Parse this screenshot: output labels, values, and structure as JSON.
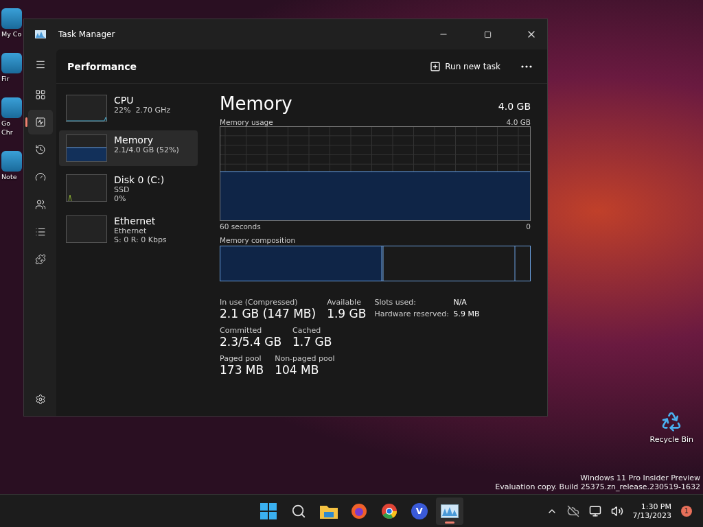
{
  "desktop_icons": [
    {
      "lines": [
        "My Co"
      ]
    },
    {
      "lines": [
        "Fir"
      ]
    },
    {
      "lines": [
        "Go",
        "Chr"
      ]
    },
    {
      "lines": [
        "Note"
      ]
    }
  ],
  "recycle_bin": {
    "label": "Recycle Bin"
  },
  "watermark": [
    "Windows 11 Pro Insider Preview",
    "Evaluation copy. Build 25375.zn_release.230519-1632"
  ],
  "window": {
    "title": "Task Manager"
  },
  "nav": [
    {
      "kind": "menu",
      "selected": false
    },
    {
      "kind": "processes",
      "selected": false
    },
    {
      "kind": "performance",
      "selected": true
    },
    {
      "kind": "history",
      "selected": false
    },
    {
      "kind": "startup",
      "selected": false
    },
    {
      "kind": "users",
      "selected": false
    },
    {
      "kind": "details",
      "selected": false
    },
    {
      "kind": "services",
      "selected": false
    }
  ],
  "header": {
    "title": "Performance",
    "run_task": "Run new task"
  },
  "devices": [
    {
      "kind": "cpu",
      "name": "CPU",
      "lines": [
        "22%  2.70 GHz"
      ],
      "selected": false
    },
    {
      "kind": "memory",
      "name": "Memory",
      "lines": [
        "2.1/4.0 GB (52%)"
      ],
      "selected": true
    },
    {
      "kind": "disk",
      "name": "Disk 0 (C:)",
      "lines": [
        "SSD",
        "0%"
      ],
      "selected": false
    },
    {
      "kind": "net",
      "name": "Ethernet",
      "lines": [
        "Ethernet",
        "S: 0 R: 0 Kbps"
      ],
      "selected": false
    }
  ],
  "detail": {
    "title": "Memory",
    "total": "4.0 GB",
    "usage_label": "Memory usage",
    "usage_max": "4.0 GB",
    "time_label": "60 seconds",
    "time_end": "0",
    "composition_label": "Memory composition",
    "stats": [
      [
        {
          "label": "In use (Compressed)",
          "value": "2.1 GB (147 MB)"
        },
        {
          "label": "Available",
          "value": "1.9 GB"
        }
      ],
      [
        {
          "label": "Committed",
          "value": "2.3/5.4 GB"
        },
        {
          "label": "Cached",
          "value": "1.7 GB"
        }
      ],
      [
        {
          "label": "Paged pool",
          "value": "173 MB"
        },
        {
          "label": "Non-paged pool",
          "value": "104 MB"
        }
      ]
    ],
    "side": [
      {
        "label": "Slots used:",
        "value": "N/A"
      },
      {
        "label": "Hardware reserved:",
        "value": "5.9 MB"
      }
    ]
  },
  "taskbar": {
    "apps": [
      {
        "kind": "start",
        "selected": false
      },
      {
        "kind": "search",
        "selected": false
      },
      {
        "kind": "folder",
        "selected": false
      },
      {
        "kind": "firefox",
        "selected": false
      },
      {
        "kind": "chrome",
        "selected": false
      },
      {
        "kind": "v",
        "label": "V",
        "selected": false
      },
      {
        "kind": "taskmgr",
        "selected": true
      }
    ],
    "time": "1:30 PM",
    "date": "7/13/2023",
    "badge": "1"
  }
}
